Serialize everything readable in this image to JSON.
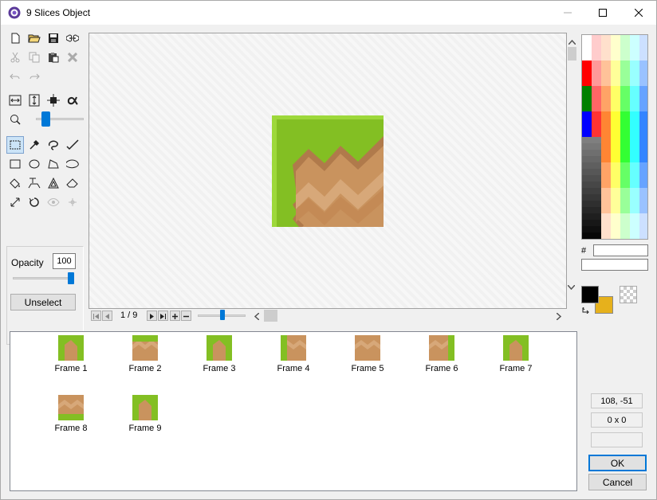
{
  "window": {
    "title": "9 Slices Object",
    "app_icon": "gamemaker-icon",
    "controls": [
      "minimize-icon",
      "maximize-icon",
      "close-icon"
    ]
  },
  "toolbox": {
    "file_tools": [
      "new-icon",
      "open-icon",
      "save-icon",
      "bone-icon"
    ],
    "edit_tools": [
      "cut-icon",
      "copy-icon",
      "paste-icon",
      "delete-icon"
    ],
    "history_tools": [
      "undo-icon",
      "redo-icon"
    ],
    "transform_tools": [
      "resize-width-icon",
      "resize-height-icon",
      "stretch-icon",
      "alpha-icon"
    ],
    "zoom_icon": "magnifier-icon",
    "draw_tools": [
      "select-rect-icon",
      "eyedropper-icon",
      "freehand-select-icon",
      "pencil-icon",
      "rectangle-icon",
      "ellipse-icon",
      "polygon-icon",
      "rounded-rect-icon",
      "fill-icon",
      "text-fill-icon",
      "triangle-icon",
      "eraser-icon",
      "line-icon",
      "rotate-icon",
      "eye-icon",
      "magic-icon"
    ],
    "active_tool": "select-rect-icon"
  },
  "properties": {
    "opacity_label": "Opacity",
    "opacity_value": "100",
    "opacity_level": 1.0,
    "unselect_label": "Unselect"
  },
  "navigation": {
    "frame_counter": "1 / 9",
    "buttons": [
      "first-frame-icon",
      "prev-frame-icon",
      "next-frame-icon",
      "last-frame-icon",
      "add-frame-icon",
      "remove-frame-icon"
    ]
  },
  "palette": {
    "hex_label": "#",
    "hex_value": "",
    "color_name": "",
    "foreground": "#000000",
    "background": "#e6b11c"
  },
  "frames": [
    {
      "label": "Frame 1",
      "variant": "tl"
    },
    {
      "label": "Frame 2",
      "variant": "t"
    },
    {
      "label": "Frame 3",
      "variant": "tr"
    },
    {
      "label": "Frame 4",
      "variant": "l"
    },
    {
      "label": "Frame 5",
      "variant": "c"
    },
    {
      "label": "Frame 6",
      "variant": "r"
    },
    {
      "label": "Frame 7",
      "variant": "bl"
    },
    {
      "label": "Frame 8",
      "variant": "b"
    },
    {
      "label": "Frame 9",
      "variant": "br"
    }
  ],
  "status": {
    "coordinates": "108, -51",
    "selection_size": "0 x 0",
    "extra": ""
  },
  "buttons": {
    "ok": "OK",
    "cancel": "Cancel"
  }
}
